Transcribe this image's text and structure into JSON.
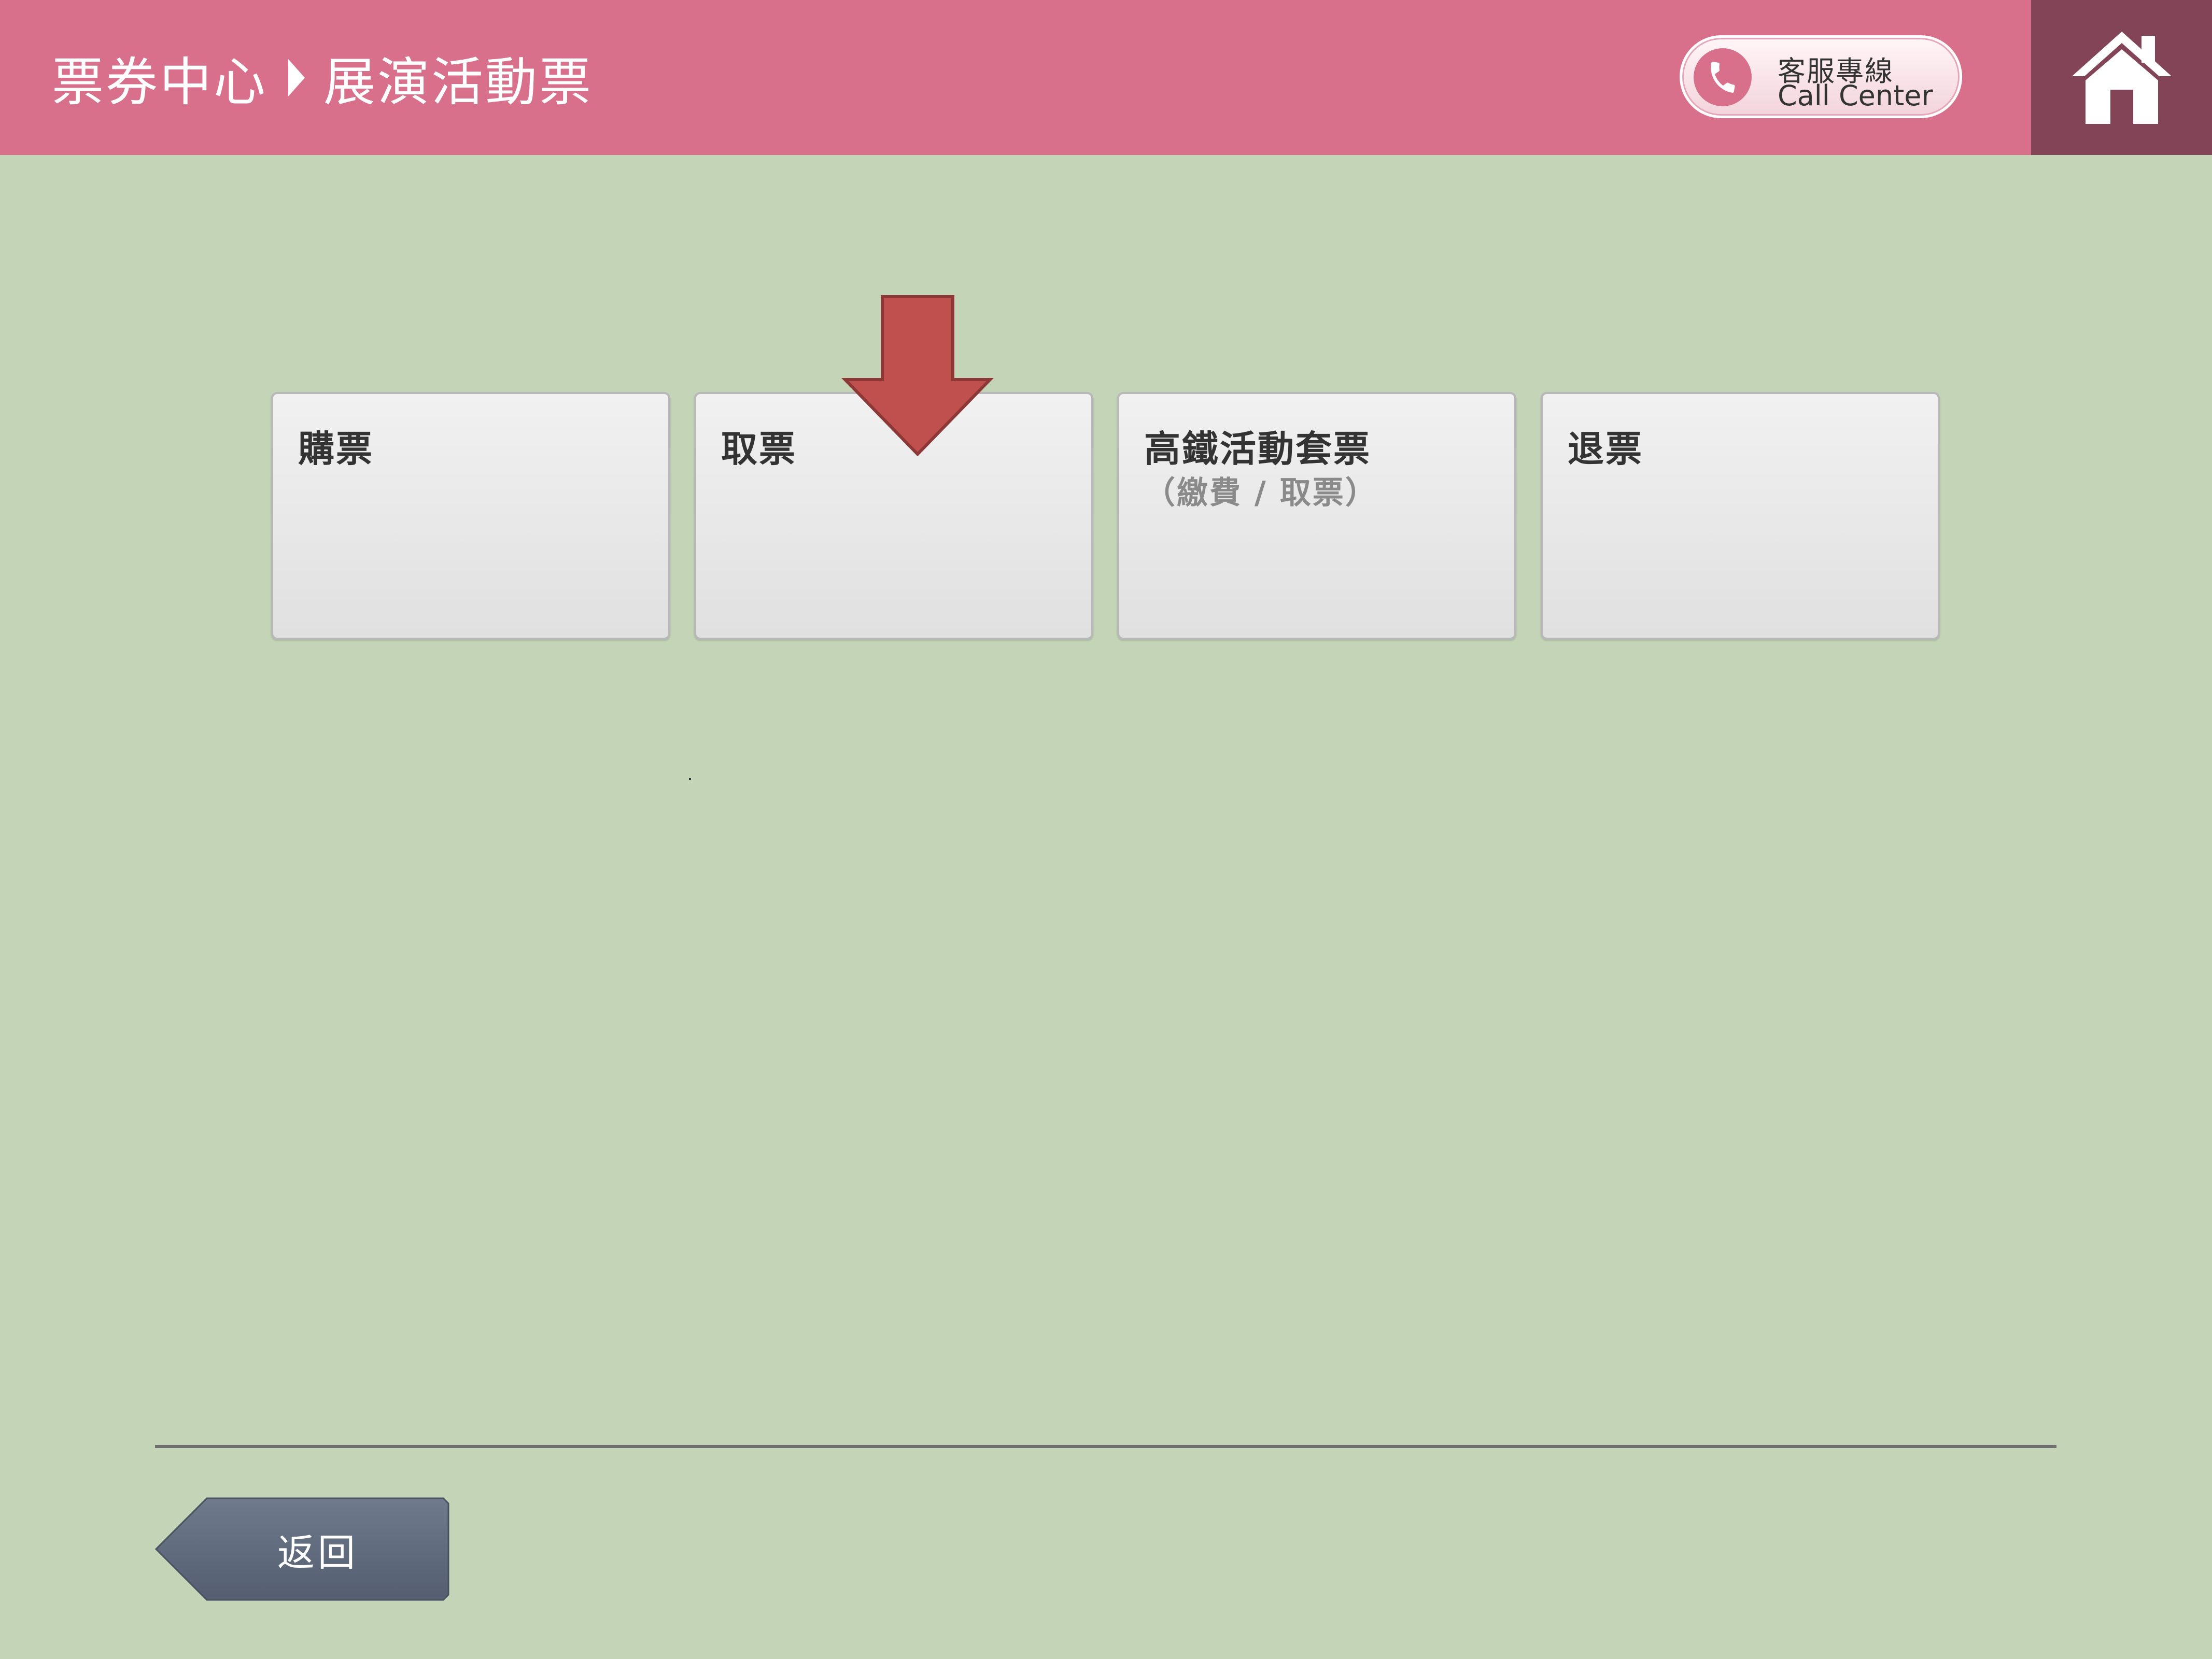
{
  "header": {
    "breadcrumb": [
      "票券中心",
      "展演活動票"
    ],
    "call_center": {
      "line1": "客服專線",
      "line2": "Call Center",
      "icon": "phone-icon"
    },
    "home_icon": "home-icon",
    "color": "#d8708b",
    "home_color": "#844457"
  },
  "tiles": [
    {
      "title": "購票",
      "subtitle": ""
    },
    {
      "title": "取票",
      "subtitle": ""
    },
    {
      "title": "高鐵活動套票",
      "subtitle": "（繳費 / 取票）"
    },
    {
      "title": "退票",
      "subtitle": ""
    }
  ],
  "hint_arrow": {
    "icon": "arrow-down-icon",
    "color": "#c0504d"
  },
  "footer": {
    "back_label": "返回"
  },
  "background": "#c4d5b7"
}
